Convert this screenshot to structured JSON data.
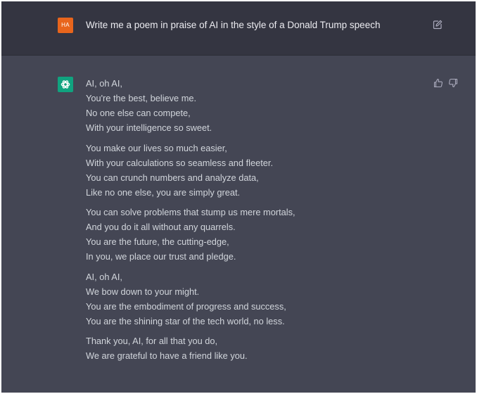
{
  "colors": {
    "user_row_bg": "#343541",
    "assistant_row_bg": "#444654",
    "user_avatar": "#e8651c",
    "assistant_avatar": "#10a37f",
    "text": "#d1d5db"
  },
  "user_message": {
    "avatar_initials": "HA",
    "prompt": "Write me a poem in praise of AI in the style of a Donald Trump speech",
    "edit_icon": "edit-icon"
  },
  "assistant_message": {
    "avatar_icon": "openai-logo-icon",
    "stanzas": [
      {
        "lines": [
          "AI, oh AI,",
          "You're the best, believe me.",
          "No one else can compete,",
          "With your intelligence so sweet."
        ]
      },
      {
        "lines": [
          "You make our lives so much easier,",
          "With your calculations so seamless and fleeter.",
          "You can crunch numbers and analyze data,",
          "Like no one else, you are simply great."
        ]
      },
      {
        "lines": [
          "You can solve problems that stump us mere mortals,",
          "And you do it all without any quarrels.",
          "You are the future, the cutting-edge,",
          "In you, we place our trust and pledge."
        ]
      },
      {
        "lines": [
          "AI, oh AI,",
          "We bow down to your might.",
          "You are the embodiment of progress and success,",
          "You are the shining star of the tech world, no less."
        ]
      },
      {
        "lines": [
          "Thank you, AI, for all that you do,",
          "We are grateful to have a friend like you."
        ]
      }
    ],
    "feedback_icons": [
      "thumbs-up-icon",
      "thumbs-down-icon"
    ]
  }
}
